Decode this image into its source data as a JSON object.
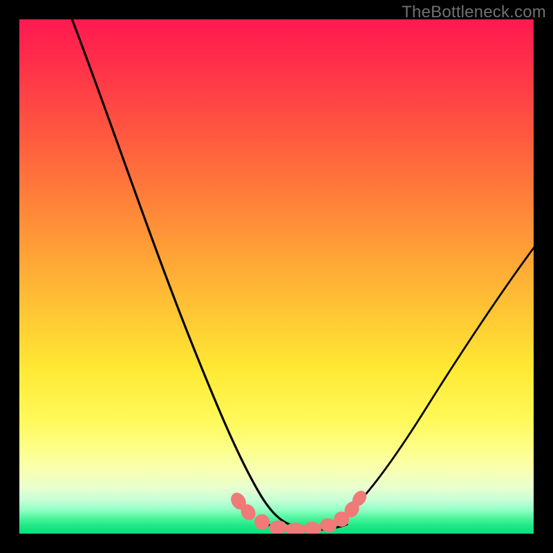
{
  "watermark": "TheBottleneck.com",
  "colors": {
    "page_bg": "#000000",
    "curve_stroke": "#000000",
    "marker_fill": "#ef7a78",
    "gradient_top": "#ff1950",
    "gradient_bottom": "#0be07d"
  },
  "chart_data": {
    "type": "line",
    "title": "",
    "xlabel": "",
    "ylabel": "",
    "xlim": [
      0,
      100
    ],
    "ylim": [
      0,
      100
    ],
    "note": "No axes, ticks, or numeric labels are rendered; values are estimated from curve geometry on a 0–100 normalized grid.",
    "series": [
      {
        "name": "left-curve",
        "x": [
          10,
          14,
          18,
          22,
          26,
          30,
          34,
          37,
          39,
          41,
          43,
          45,
          47
        ],
        "y": [
          100,
          86,
          72,
          59,
          47,
          36,
          26,
          18,
          12,
          8,
          5,
          3,
          2
        ]
      },
      {
        "name": "trough",
        "x": [
          47,
          49,
          51,
          53,
          55,
          57,
          59,
          61
        ],
        "y": [
          2,
          1.2,
          0.8,
          0.7,
          0.7,
          0.9,
          1.4,
          2.3
        ]
      },
      {
        "name": "right-curve",
        "x": [
          61,
          64,
          68,
          72,
          76,
          80,
          84,
          88,
          92,
          96,
          100
        ],
        "y": [
          2.3,
          5,
          9,
          14,
          20,
          26,
          32,
          38,
          44,
          50,
          56
        ]
      }
    ],
    "markers": {
      "name": "trough-markers",
      "points": [
        {
          "x": 42.0,
          "y": 6.0
        },
        {
          "x": 43.5,
          "y": 4.0
        },
        {
          "x": 46.0,
          "y": 2.2
        },
        {
          "x": 48.5,
          "y": 1.3
        },
        {
          "x": 51.0,
          "y": 0.9
        },
        {
          "x": 53.5,
          "y": 0.8
        },
        {
          "x": 56.0,
          "y": 1.0
        },
        {
          "x": 58.5,
          "y": 1.5
        },
        {
          "x": 61.0,
          "y": 2.4
        },
        {
          "x": 63.0,
          "y": 4.2
        },
        {
          "x": 64.5,
          "y": 6.5
        }
      ]
    }
  }
}
